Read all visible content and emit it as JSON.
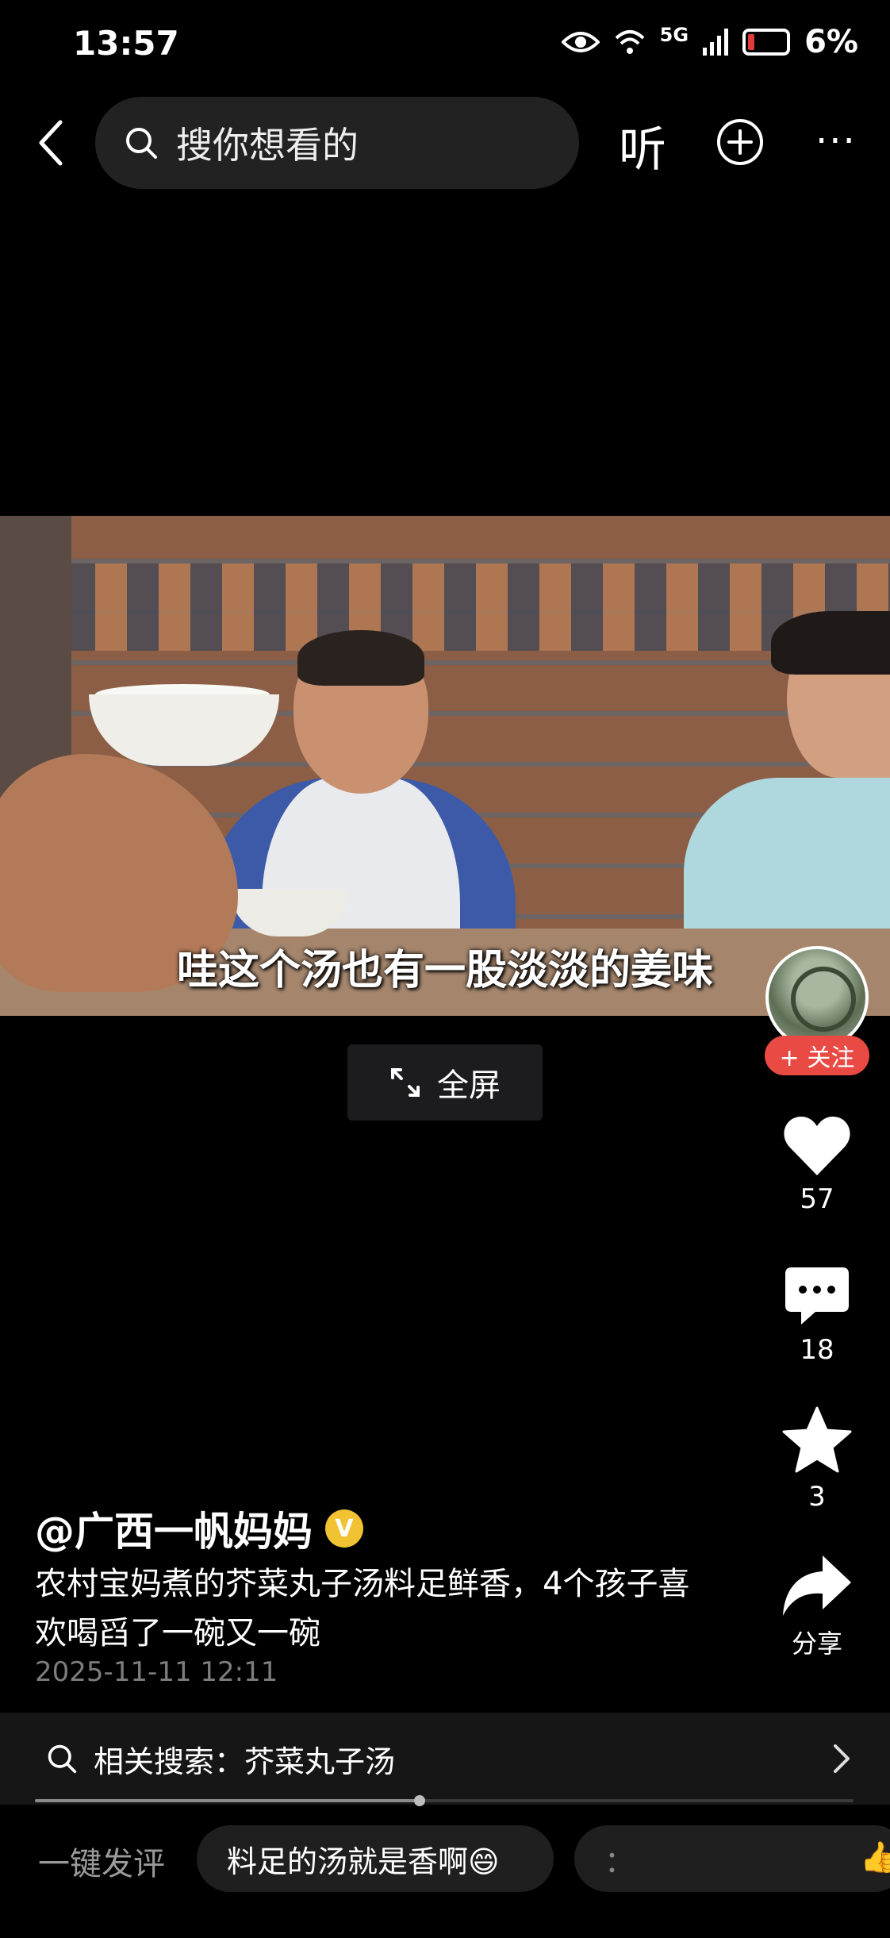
{
  "status_bar": {
    "time": "13:57",
    "network": "5G",
    "battery": "6%"
  },
  "nav": {
    "search_placeholder": "搜你想看的",
    "listen_label": "听",
    "more_label": "···"
  },
  "video": {
    "subtitle": "哇这个汤也有一股淡淡的姜味",
    "fullscreen_label": "全屏",
    "playback_progress": 0.47
  },
  "rail": {
    "follow_label": "+ 关注",
    "likes": "57",
    "comments": "18",
    "favorites": "3",
    "share_label": "分享"
  },
  "post": {
    "author": "@广西一帆妈妈",
    "badge": "V",
    "caption": "农村宝妈煮的芥菜丸子汤料足鲜香，4个孩子喜欢喝舀了一碗又一碗",
    "date": "2025-11-11 12:11"
  },
  "related_search": {
    "label": "相关搜索：芥菜丸子汤"
  },
  "quick_comment": {
    "label": "一键发评",
    "chips": [
      "料足的汤就是香啊😄",
      "：",
      "👍"
    ]
  },
  "colors": {
    "follow_red": "#e94a44",
    "badge_gold": "#f1c232"
  },
  "icons": [
    "chevron-left-icon",
    "search-icon",
    "plus-circle-icon",
    "expand-icon",
    "heart-icon",
    "comment-icon",
    "star-icon",
    "share-icon",
    "chevron-right-icon",
    "eye-icon",
    "wifi-icon",
    "signal-icon",
    "battery-icon"
  ]
}
